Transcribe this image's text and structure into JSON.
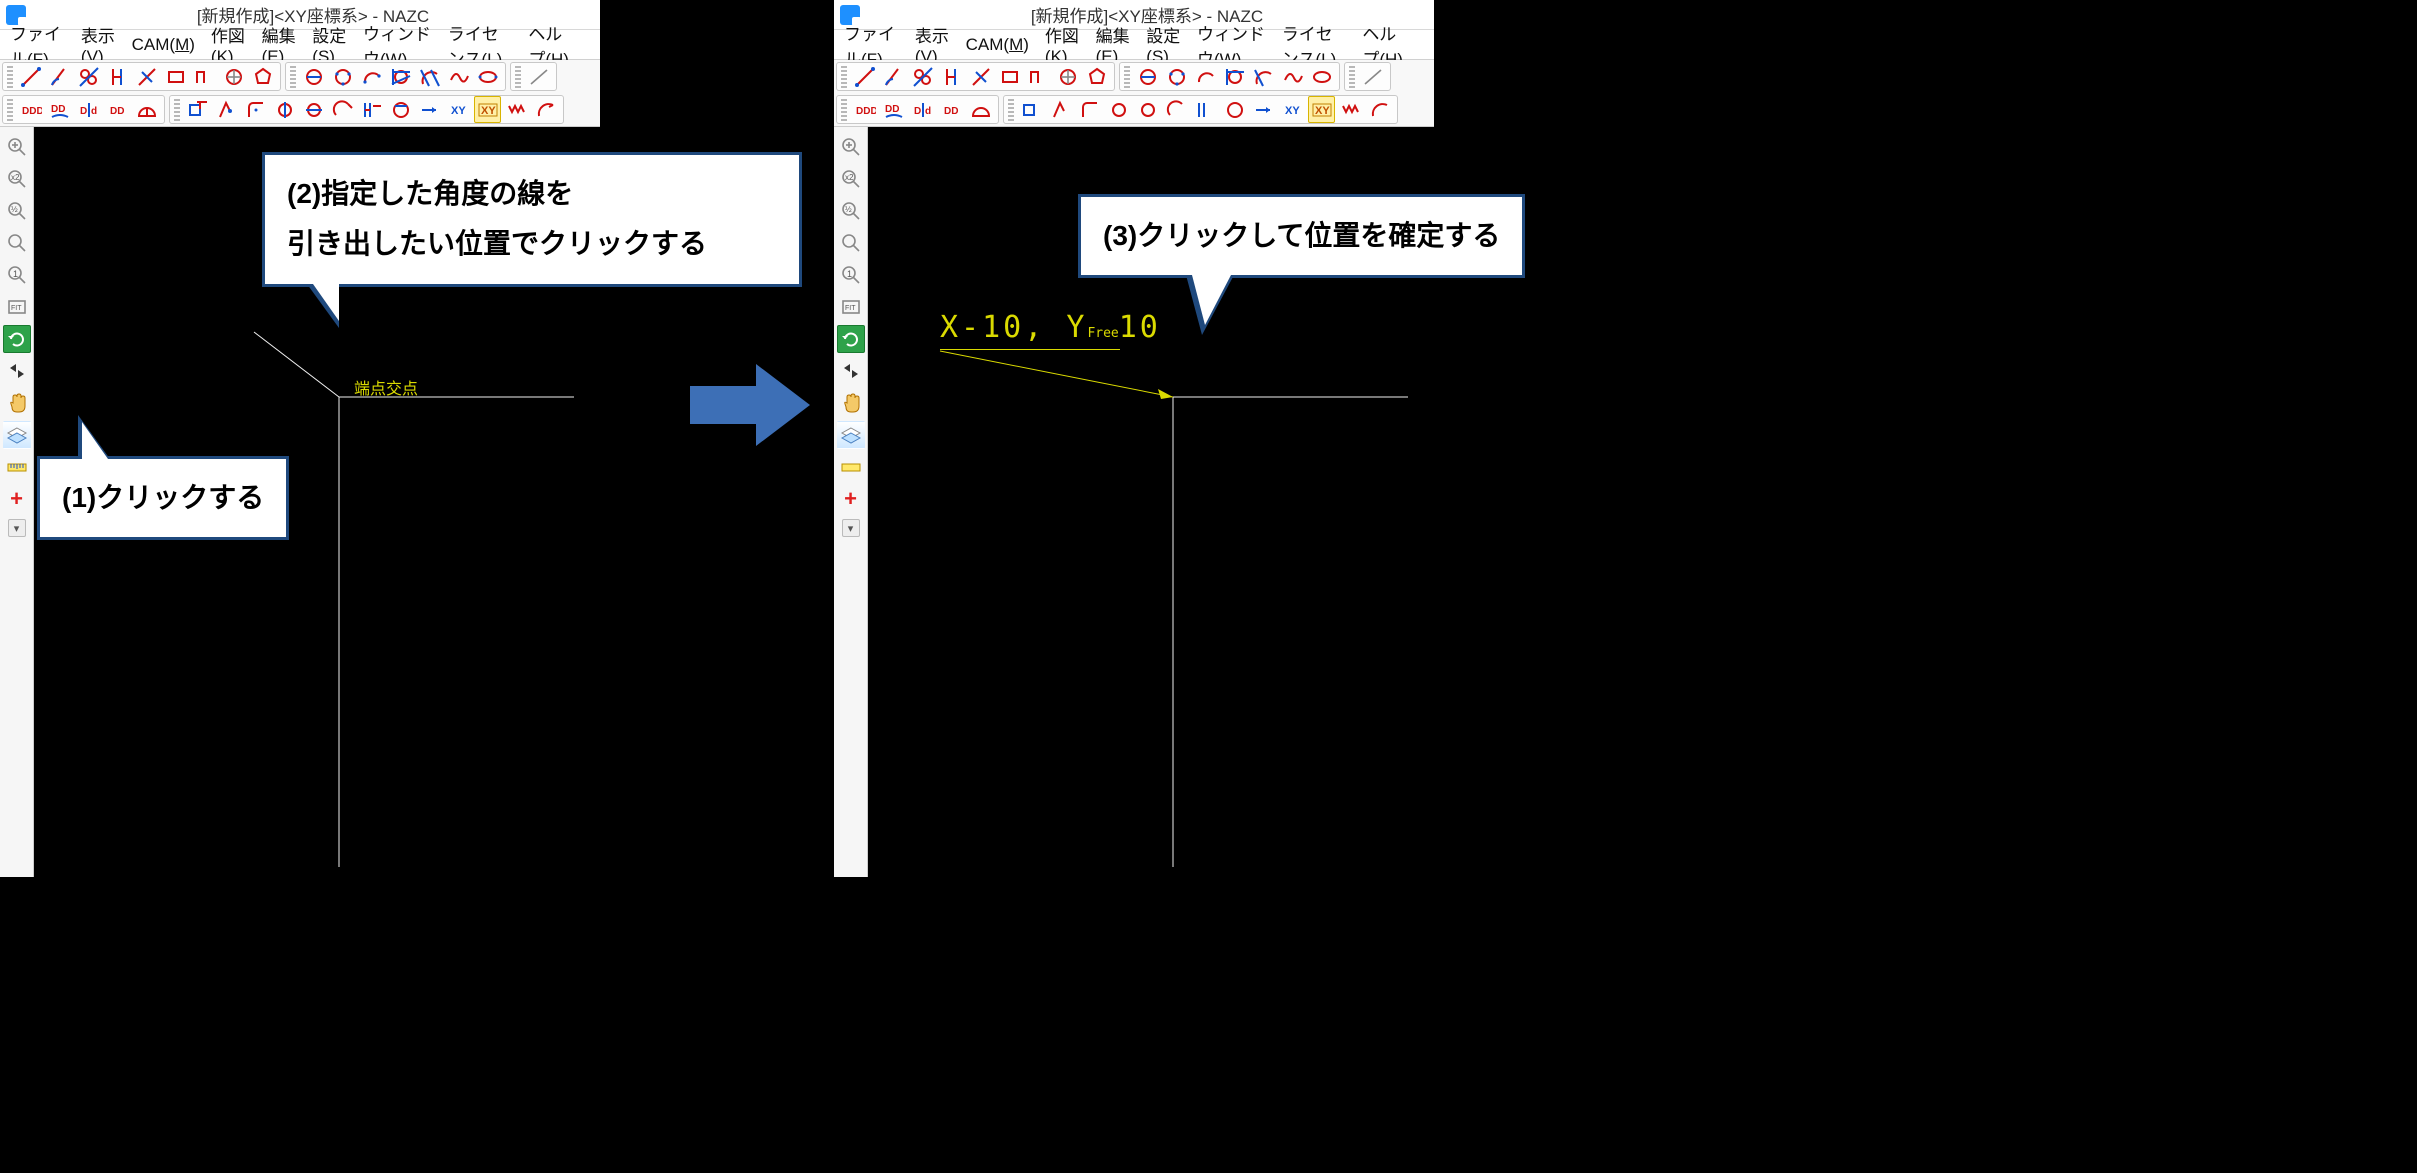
{
  "title": "[新規作成]<XY座標系> - NAZC",
  "menu": {
    "file": {
      "label": "ファイル",
      "ul": "F"
    },
    "view": {
      "label": "表示",
      "ul": "V"
    },
    "cam": {
      "label": "CAM",
      "ul": "M"
    },
    "draw": {
      "label": "作図",
      "ul": "K"
    },
    "edit": {
      "label": "編集",
      "ul": "E"
    },
    "setting": {
      "label": "設定",
      "ul": "S"
    },
    "window": {
      "label": "ウィンドウ",
      "ul": "W"
    },
    "license": {
      "label": "ライセンス",
      "ul": "L"
    },
    "help": {
      "label": "ヘルプ",
      "ul": "H"
    }
  },
  "callout1": "(1)クリックする",
  "callout2_l1": "(2)指定した角度の線を",
  "callout2_l2": "引き出したい位置でクリックする",
  "callout3": "(3)クリックして位置を確定する",
  "snap_hint": "端点交点",
  "coord_text": "X-10, Y",
  "coord_text2": "10",
  "coord_sub": "Free",
  "vtool": {
    "zoom_in": "zoom-in",
    "zoom_x2": "×2",
    "zoom_half": "½",
    "zoom": "zoom",
    "zoom_1": "1",
    "fit": "FIT",
    "refresh": "refresh",
    "undo": "undo-redo",
    "pan": "pan-hand",
    "layers": "layers",
    "ruler": "ruler",
    "origin": "+"
  }
}
